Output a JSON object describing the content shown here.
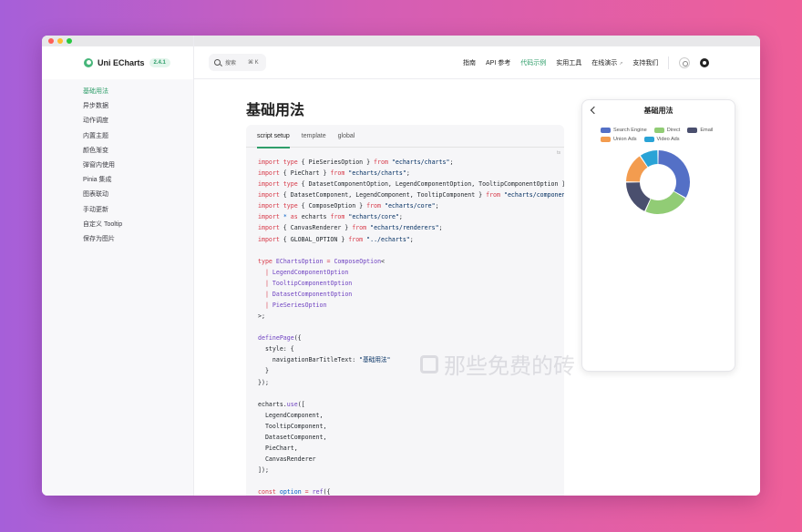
{
  "app": {
    "brand": "Uni ECharts",
    "version": "2.4.1"
  },
  "search": {
    "placeholder": "搜索",
    "shortcut": "⌘ K"
  },
  "nav": {
    "items": [
      {
        "label": "指南"
      },
      {
        "label": "API 参考"
      },
      {
        "label": "代码示例"
      },
      {
        "label": "实用工具"
      },
      {
        "label": "在线演示"
      },
      {
        "label": "支持我们"
      }
    ],
    "external_marker": "↗"
  },
  "sidebar": {
    "items": [
      {
        "label": "基础用法"
      },
      {
        "label": "异步数据"
      },
      {
        "label": "动作调度"
      },
      {
        "label": "内置主题"
      },
      {
        "label": "颜色渐变"
      },
      {
        "label": "弹窗内使用"
      },
      {
        "label": "Pinia 集成"
      },
      {
        "label": "图表联动"
      },
      {
        "label": "手动更新"
      },
      {
        "label": "自定义 Tooltip"
      },
      {
        "label": "保存为图片"
      }
    ]
  },
  "page": {
    "title": "基础用法"
  },
  "code": {
    "tabs": [
      {
        "label": "script setup"
      },
      {
        "label": "template"
      },
      {
        "label": "global"
      }
    ],
    "lang": "ts"
  },
  "watermark": {
    "text": "那些免费的砖"
  },
  "preview": {
    "title": "基础用法",
    "legend": [
      {
        "name": "Search Engine",
        "color": "#5470c6"
      },
      {
        "name": "Direct",
        "color": "#91cc75"
      },
      {
        "name": "Email",
        "color": "#4a4f6e"
      },
      {
        "name": "Union Ads",
        "color": "#f39c4f"
      },
      {
        "name": "Video Ads",
        "color": "#2aa3d6"
      }
    ],
    "slices": [
      {
        "name": "Search Engine",
        "value": 1048,
        "color": "#5470c6"
      },
      {
        "name": "Direct",
        "value": 735,
        "color": "#91cc75"
      },
      {
        "name": "Email",
        "value": 580,
        "color": "#4a4f6e"
      },
      {
        "name": "Union Ads",
        "value": 484,
        "color": "#f39c4f"
      },
      {
        "name": "Video Ads",
        "value": 300,
        "color": "#2aa3d6"
      }
    ]
  }
}
